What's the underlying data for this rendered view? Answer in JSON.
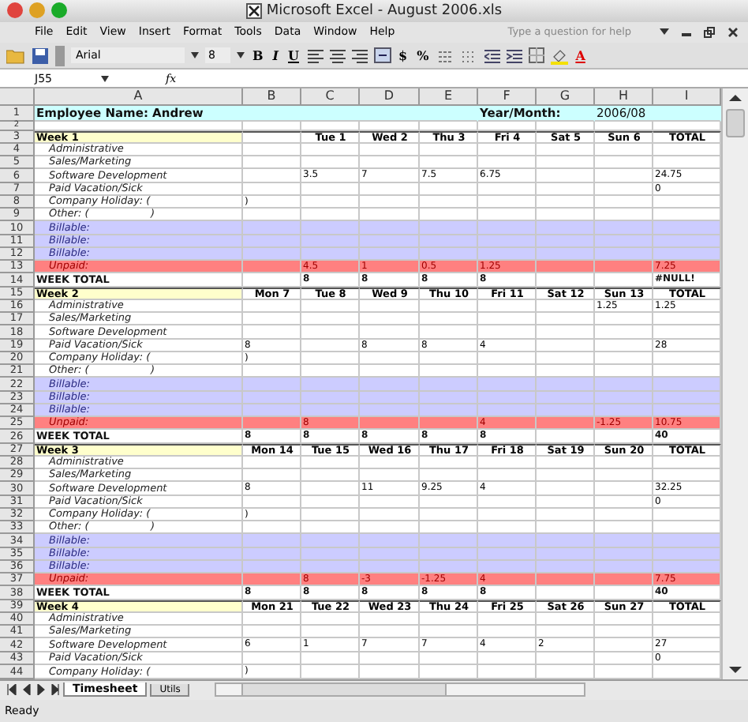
{
  "window": {
    "title": "Microsoft Excel - August 2006.xls"
  },
  "menu": [
    "File",
    "Edit",
    "View",
    "Insert",
    "Format",
    "Tools",
    "Data",
    "Window",
    "Help"
  ],
  "help_placeholder": "Type a question for help",
  "toolbar": {
    "font": "Arial",
    "size": "8",
    "style_buttons": [
      "B",
      "I",
      "U"
    ],
    "number_buttons": [
      "$",
      "%"
    ],
    "font_color": "A"
  },
  "formula_bar": {
    "cell_ref": "J55",
    "fx": "fx"
  },
  "columns": [
    "A",
    "B",
    "C",
    "D",
    "E",
    "F",
    "G",
    "H",
    "I"
  ],
  "rows": [
    {
      "n": "1",
      "kind": "title",
      "cells": {
        "A": "Employee Name: Andrew",
        "F": "Year/Month:",
        "H": "2006/08"
      }
    },
    {
      "n": "2",
      "kind": "blank",
      "cells": {}
    },
    {
      "n": "3",
      "kind": "week",
      "cells": {
        "A": "Week 1",
        "C": "Tue 1",
        "D": "Wed 2",
        "E": "Thu 3",
        "F": "Fri 4",
        "G": "Sat 5",
        "H": "Sun 6",
        "I": "TOTAL"
      }
    },
    {
      "n": "4",
      "kind": "item",
      "cells": {
        "A": "Administrative"
      }
    },
    {
      "n": "5",
      "kind": "item",
      "cells": {
        "A": "Sales/Marketing"
      }
    },
    {
      "n": "6",
      "kind": "item",
      "cells": {
        "A": "Software Development",
        "C": "3.5",
        "D": "7",
        "E": "7.5",
        "F": "6.75",
        "I": "24.75"
      }
    },
    {
      "n": "7",
      "kind": "item",
      "cells": {
        "A": "Paid Vacation/Sick",
        "I": "0"
      }
    },
    {
      "n": "8",
      "kind": "item",
      "cells": {
        "A": "Company Holiday: (",
        "B": ")"
      }
    },
    {
      "n": "9",
      "kind": "item",
      "cells": {
        "A": "Other: (                   )"
      }
    },
    {
      "n": "10",
      "kind": "billable",
      "cells": {
        "A": "Billable:"
      }
    },
    {
      "n": "11",
      "kind": "billable",
      "cells": {
        "A": "Billable:"
      }
    },
    {
      "n": "12",
      "kind": "billable",
      "cells": {
        "A": "Billable:"
      }
    },
    {
      "n": "13",
      "kind": "unpaid",
      "cells": {
        "A": "Unpaid:",
        "C": "4.5",
        "D": "1",
        "E": "0.5",
        "F": "1.25",
        "I": "7.25"
      }
    },
    {
      "n": "14",
      "kind": "total",
      "cells": {
        "A": "WEEK TOTAL",
        "C": "8",
        "D": "8",
        "E": "8",
        "F": "8",
        "I": "#NULL!"
      }
    },
    {
      "n": "15",
      "kind": "week",
      "cells": {
        "A": "Week 2",
        "B": "Mon 7",
        "C": "Tue 8",
        "D": "Wed 9",
        "E": "Thu 10",
        "F": "Fri 11",
        "G": "Sat 12",
        "H": "Sun 13",
        "I": "TOTAL"
      }
    },
    {
      "n": "16",
      "kind": "item",
      "cells": {
        "A": "Administrative",
        "H": "1.25",
        "I": "1.25"
      }
    },
    {
      "n": "17",
      "kind": "item",
      "cells": {
        "A": "Sales/Marketing"
      }
    },
    {
      "n": "18",
      "kind": "item",
      "cells": {
        "A": "Software Development"
      }
    },
    {
      "n": "19",
      "kind": "item",
      "cells": {
        "A": "Paid Vacation/Sick",
        "B": "8",
        "D": "8",
        "E": "8",
        "F": "4",
        "I": "28"
      }
    },
    {
      "n": "20",
      "kind": "item",
      "cells": {
        "A": "Company Holiday: (",
        "B": ")"
      }
    },
    {
      "n": "21",
      "kind": "item",
      "cells": {
        "A": "Other: (                   )"
      }
    },
    {
      "n": "22",
      "kind": "billable",
      "cells": {
        "A": "Billable:"
      }
    },
    {
      "n": "23",
      "kind": "billable",
      "cells": {
        "A": "Billable:"
      }
    },
    {
      "n": "24",
      "kind": "billable",
      "cells": {
        "A": "Billable:"
      }
    },
    {
      "n": "25",
      "kind": "unpaid",
      "cells": {
        "A": "Unpaid:",
        "C": "8",
        "F": "4",
        "H": "-1.25",
        "I": "10.75"
      }
    },
    {
      "n": "26",
      "kind": "total",
      "cells": {
        "A": "WEEK TOTAL",
        "B": "8",
        "C": "8",
        "D": "8",
        "E": "8",
        "F": "8",
        "I": "40"
      }
    },
    {
      "n": "27",
      "kind": "week",
      "cells": {
        "A": "Week 3",
        "B": "Mon 14",
        "C": "Tue 15",
        "D": "Wed 16",
        "E": "Thu 17",
        "F": "Fri 18",
        "G": "Sat 19",
        "H": "Sun 20",
        "I": "TOTAL"
      }
    },
    {
      "n": "28",
      "kind": "item",
      "cells": {
        "A": "Administrative"
      }
    },
    {
      "n": "29",
      "kind": "item",
      "cells": {
        "A": "Sales/Marketing"
      }
    },
    {
      "n": "30",
      "kind": "item",
      "cells": {
        "A": "Software Development",
        "B": "8",
        "D": "11",
        "E": "9.25",
        "F": "4",
        "I": "32.25"
      }
    },
    {
      "n": "31",
      "kind": "item",
      "cells": {
        "A": "Paid Vacation/Sick",
        "I": "0"
      }
    },
    {
      "n": "32",
      "kind": "item",
      "cells": {
        "A": "Company Holiday: (",
        "B": ")"
      }
    },
    {
      "n": "33",
      "kind": "item",
      "cells": {
        "A": "Other: (                   )"
      }
    },
    {
      "n": "34",
      "kind": "billable",
      "cells": {
        "A": "Billable:"
      }
    },
    {
      "n": "35",
      "kind": "billable",
      "cells": {
        "A": "Billable:"
      }
    },
    {
      "n": "36",
      "kind": "billable",
      "cells": {
        "A": "Billable:"
      }
    },
    {
      "n": "37",
      "kind": "unpaid",
      "cells": {
        "A": "Unpaid:",
        "C": "8",
        "D": "-3",
        "E": "-1.25",
        "F": "4",
        "I": "7.75"
      }
    },
    {
      "n": "38",
      "kind": "total",
      "cells": {
        "A": "WEEK TOTAL",
        "B": "8",
        "C": "8",
        "D": "8",
        "E": "8",
        "F": "8",
        "I": "40"
      }
    },
    {
      "n": "39",
      "kind": "week",
      "cells": {
        "A": "Week 4",
        "B": "Mon 21",
        "C": "Tue 22",
        "D": "Wed 23",
        "E": "Thu 24",
        "F": "Fri 25",
        "G": "Sat 26",
        "H": "Sun 27",
        "I": "TOTAL"
      }
    },
    {
      "n": "40",
      "kind": "item",
      "cells": {
        "A": "Administrative"
      }
    },
    {
      "n": "41",
      "kind": "item",
      "cells": {
        "A": "Sales/Marketing"
      }
    },
    {
      "n": "42",
      "kind": "item",
      "cells": {
        "A": "Software Development",
        "B": "6",
        "C": "1",
        "D": "7",
        "E": "7",
        "F": "4",
        "G": "2",
        "I": "27"
      }
    },
    {
      "n": "43",
      "kind": "item",
      "cells": {
        "A": "Paid Vacation/Sick",
        "I": "0"
      }
    },
    {
      "n": "44",
      "kind": "item",
      "cells": {
        "A": "Company Holiday: (",
        "B": ")"
      }
    }
  ],
  "sheet_tabs": [
    {
      "label": "Timesheet",
      "selected": true
    },
    {
      "label": "Utils",
      "selected": false
    }
  ],
  "status_bar": "Ready"
}
